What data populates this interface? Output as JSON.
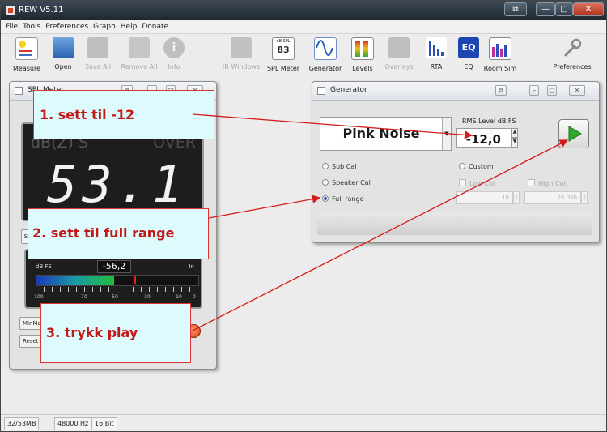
{
  "window": {
    "title": "REW V5.11",
    "controls": {
      "restore": "⧉",
      "minimize": "—",
      "maximize": "□",
      "close": "✕"
    }
  },
  "menu": [
    "File",
    "Tools",
    "Preferences",
    "Graph",
    "Help",
    "Donate"
  ],
  "toolbar": [
    {
      "id": "measure",
      "label": "Measure",
      "enabled": true
    },
    {
      "id": "open",
      "label": "Open",
      "enabled": true
    },
    {
      "id": "save-all",
      "label": "Save All",
      "enabled": false
    },
    {
      "id": "remove-all",
      "label": "Remove All",
      "enabled": false
    },
    {
      "id": "info",
      "label": "Info",
      "enabled": false
    },
    {
      "id": "ir-windows",
      "label": "IR Windows",
      "enabled": false
    },
    {
      "id": "spl-meter",
      "label": "SPL Meter",
      "enabled": true,
      "icon_top": "dB SPL",
      "icon_value": "83"
    },
    {
      "id": "generator",
      "label": "Generator",
      "enabled": true
    },
    {
      "id": "levels",
      "label": "Levels",
      "enabled": true
    },
    {
      "id": "overlays",
      "label": "Overlays",
      "enabled": false
    },
    {
      "id": "rta",
      "label": "RTA",
      "enabled": true
    },
    {
      "id": "eq",
      "label": "EQ",
      "enabled": true,
      "icon_text": "EQ"
    },
    {
      "id": "room-sim",
      "label": "Room Sim",
      "enabled": true
    },
    {
      "id": "preferences",
      "label": "Preferences",
      "enabled": true
    }
  ],
  "spl_meter": {
    "title": "SPL Meter",
    "weighting": "dB(Z) S",
    "over": "OVER",
    "reading": "53.1",
    "input_level": "-56,2",
    "level_label": "dB FS",
    "level_unit": "In",
    "level_fraction": 0.48,
    "scale": [
      "-100",
      "-70",
      "-50",
      "-30",
      "-10",
      "0"
    ],
    "buttons": {
      "minmax": "MinMax",
      "reset": "Reset",
      "sp": "SP"
    }
  },
  "generator": {
    "title": "Generator",
    "signal": "Pink Noise",
    "rms_label": "RMS Level dB FS",
    "rms_value": "-12,0",
    "options": {
      "sub_cal": "Sub Cal",
      "speaker_cal": "Speaker Cal",
      "full_range": "Full range",
      "custom": "Custom"
    },
    "low_cut": {
      "label": "Low Cut",
      "value": "10"
    },
    "high_cut": {
      "label": "High Cut",
      "value": "20 000"
    }
  },
  "callouts": {
    "step1": "1. sett til -12",
    "step2": "2. sett til full range",
    "step3": "3. trykk play"
  },
  "status": {
    "memory": "32/53MB",
    "sample_rate": "48000 Hz",
    "bit_depth": "16 Bit"
  },
  "colors": {
    "arrow": "#d41c1c",
    "play_green": "#2fa82f"
  }
}
